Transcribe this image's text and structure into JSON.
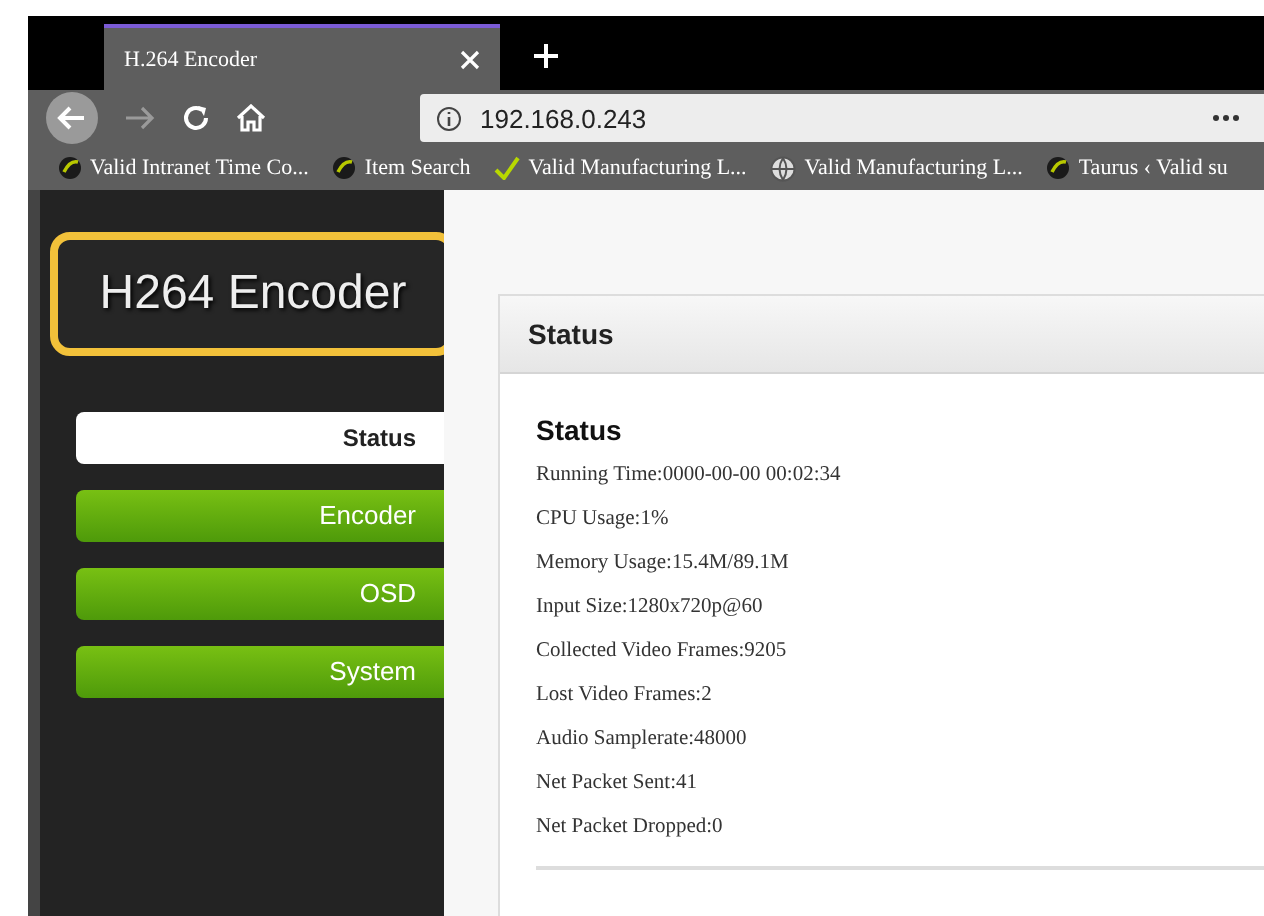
{
  "browser": {
    "tab": {
      "title": "H.264 Encoder",
      "selected": true
    },
    "address": "192.168.0.243",
    "bookmarks": [
      {
        "kind": "logo",
        "label": "Valid Intranet Time Co..."
      },
      {
        "kind": "logo",
        "label": "Item Search"
      },
      {
        "kind": "check",
        "label": "Valid Manufacturing L..."
      },
      {
        "kind": "globe",
        "label": "Valid Manufacturing L..."
      },
      {
        "kind": "logo",
        "label": "Taurus ‹ Valid su"
      }
    ]
  },
  "sidebar": {
    "logo": "H264 Encoder",
    "items": [
      {
        "label": "Status",
        "selected": true
      },
      {
        "label": "Encoder",
        "selected": false
      },
      {
        "label": "OSD",
        "selected": false
      },
      {
        "label": "System",
        "selected": false
      }
    ]
  },
  "panel": {
    "title": "Status",
    "section": "Status",
    "lines": [
      "Running Time:0000-00-00 00:02:34",
      "CPU Usage:1%",
      "Memory Usage:15.4M/89.1M",
      "Input Size:1280x720p@60",
      "Collected Video Frames:9205",
      "Lost Video Frames:2",
      "Audio Samplerate:48000",
      "Net Packet Sent:41",
      "Net Packet Dropped:0"
    ]
  }
}
